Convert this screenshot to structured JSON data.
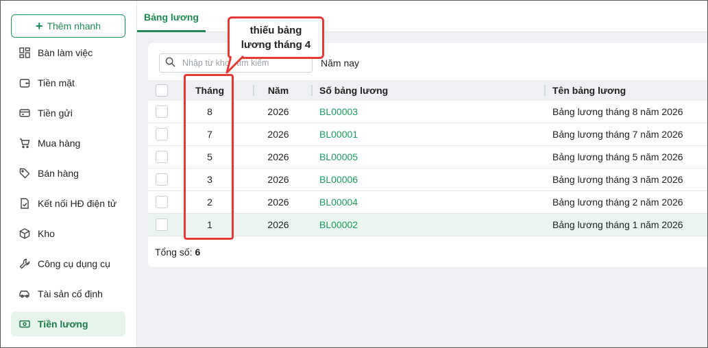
{
  "sidebar": {
    "quick_add_label": "Thêm nhanh",
    "items": [
      {
        "label": "Bàn làm việc",
        "icon": "dashboard-icon"
      },
      {
        "label": "Tiền mặt",
        "icon": "wallet-icon"
      },
      {
        "label": "Tiền gửi",
        "icon": "card-icon"
      },
      {
        "label": "Mua hàng",
        "icon": "cart-icon"
      },
      {
        "label": "Bán hàng",
        "icon": "tag-icon"
      },
      {
        "label": "Kết nối HĐ điện tử",
        "icon": "invoice-icon"
      },
      {
        "label": "Kho",
        "icon": "box-icon"
      },
      {
        "label": "Công cụ dụng cụ",
        "icon": "wrench-icon"
      },
      {
        "label": "Tài sản cố định",
        "icon": "car-icon"
      },
      {
        "label": "Tiền lương",
        "icon": "money-icon",
        "active": true
      }
    ]
  },
  "tabs": {
    "active_label": "Bảng lương"
  },
  "toolbar": {
    "search_placeholder": "Nhập từ khoá tìm kiếm",
    "year_filter": "Năm nay"
  },
  "table": {
    "headers": {
      "month": "Tháng",
      "year": "Năm",
      "code": "Số bảng lương",
      "name": "Tên bảng lương"
    },
    "rows": [
      {
        "month": "8",
        "year": "2026",
        "code": "BL00003",
        "name": "Bảng lương tháng 8 năm 2026"
      },
      {
        "month": "7",
        "year": "2026",
        "code": "BL00001",
        "name": "Bảng lương tháng 7 năm 2026"
      },
      {
        "month": "5",
        "year": "2026",
        "code": "BL00005",
        "name": "Bảng lương tháng 5 năm 2026"
      },
      {
        "month": "3",
        "year": "2026",
        "code": "BL00006",
        "name": "Bảng lương tháng 3 năm 2026"
      },
      {
        "month": "2",
        "year": "2026",
        "code": "BL00004",
        "name": "Bảng lương tháng 2 năm 2026"
      },
      {
        "month": "1",
        "year": "2026",
        "code": "BL00002",
        "name": "Bảng lương tháng 1 năm 2026",
        "selected": true
      }
    ]
  },
  "footer": {
    "total_label": "Tổng số:",
    "total_value": "6"
  },
  "annotation": {
    "line1": "thiếu bảng",
    "line2": "lương tháng 4"
  },
  "colors": {
    "accent": "#1c8a52",
    "highlight": "#e53935",
    "selected_row": "#e9f5ee"
  }
}
